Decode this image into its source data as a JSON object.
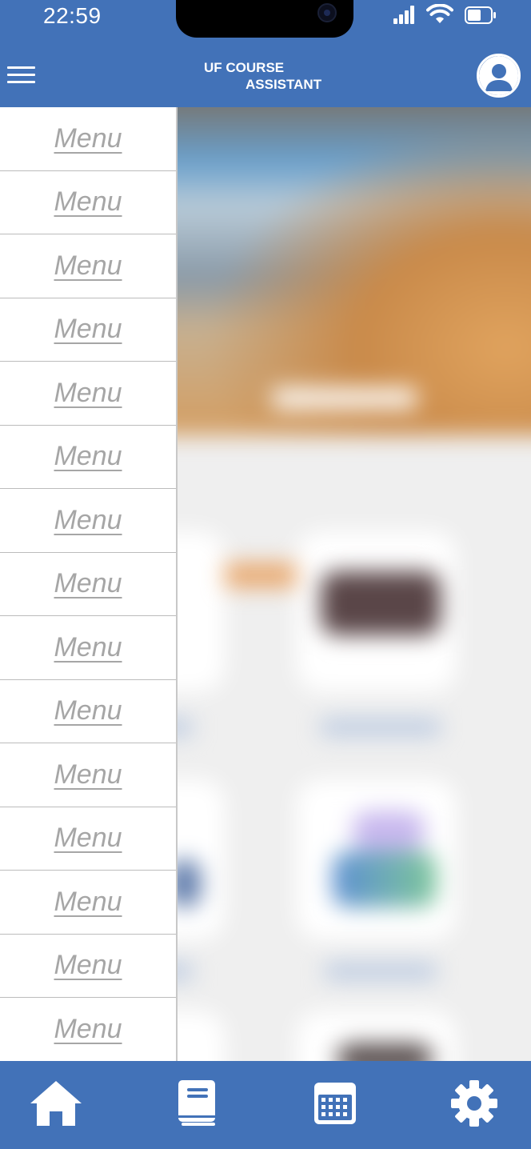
{
  "status_bar": {
    "time": "22:59"
  },
  "header": {
    "title_line1": "UF COURSE",
    "title_line2": "ASSISTANT",
    "menu_icon": "hamburger-icon",
    "profile_icon": "user-avatar-icon"
  },
  "drawer": {
    "items": [
      {
        "label": "Menu"
      },
      {
        "label": "Menu"
      },
      {
        "label": "Menu"
      },
      {
        "label": "Menu"
      },
      {
        "label": "Menu"
      },
      {
        "label": "Menu"
      },
      {
        "label": "Menu"
      },
      {
        "label": "Menu"
      },
      {
        "label": "Menu"
      },
      {
        "label": "Menu"
      },
      {
        "label": "Menu"
      },
      {
        "label": "Menu"
      },
      {
        "label": "Menu"
      },
      {
        "label": "Menu"
      },
      {
        "label": "Menu"
      }
    ]
  },
  "bottom_nav": {
    "items": [
      {
        "icon": "home-icon"
      },
      {
        "icon": "book-icon"
      },
      {
        "icon": "calendar-icon"
      },
      {
        "icon": "gear-icon"
      }
    ]
  },
  "colors": {
    "brand_blue": "#4272b8",
    "drawer_text": "#a6a6a6",
    "accent_orange": "#e8a66a"
  }
}
